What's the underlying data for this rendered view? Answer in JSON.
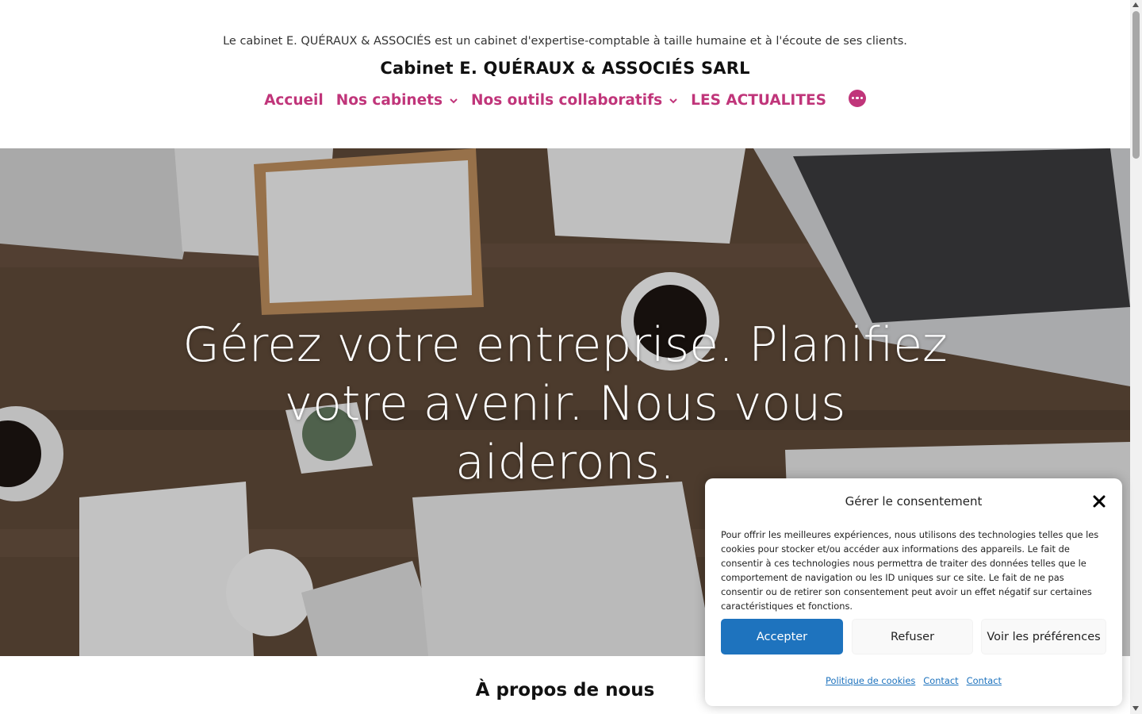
{
  "header": {
    "tagline": "Le cabinet E. QUÉRAUX & ASSOCIÉS est un cabinet d'expertise-comptable à taille humaine et à l'écoute de ses clients.",
    "site_title": "Cabinet E. QUÉRAUX & ASSOCIÉS SARL"
  },
  "nav": {
    "items": [
      {
        "label": "Accueil"
      },
      {
        "label": "Nos cabinets",
        "icon": "chevron-down-icon"
      },
      {
        "label": "Nos outils collaboratifs",
        "icon": "chevron-down-icon"
      },
      {
        "label": "LES ACTUALITES"
      }
    ],
    "more_icon": "more-dots-icon"
  },
  "hero": {
    "heading": "Gérez votre entreprise. Planifiez votre avenir. Nous vous aiderons."
  },
  "about": {
    "title": "À propos de nous"
  },
  "consent": {
    "title": "Gérer le consentement",
    "text": "Pour offrir les meilleures expériences, nous utilisons des technologies telles que les cookies pour stocker et/ou accéder aux informations des appareils. Le fait de consentir à ces technologies nous permettra de traiter des données telles que le comportement de navigation ou les ID uniques sur ce site. Le fait de ne pas consentir ou de retirer son consentement peut avoir un effet négatif sur certaines caractéristiques et fonctions.",
    "accept_label": "Accepter",
    "refuse_label": "Refuser",
    "prefs_label": "Voir les préférences",
    "links": [
      "Politique de cookies",
      "Contact",
      "Contact"
    ]
  },
  "colors": {
    "accent": "#c0357a",
    "primary_button": "#1e73be"
  }
}
